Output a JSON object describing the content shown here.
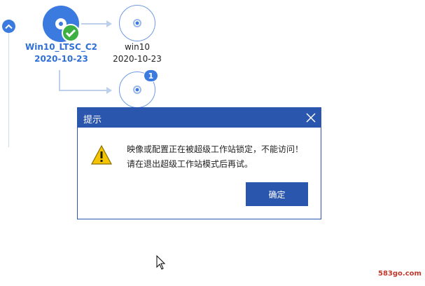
{
  "timeline": {
    "nodes": [
      {
        "name": "Win10_LTSC_C2",
        "date": "2020-10-23"
      },
      {
        "name": "win10",
        "date": "2020-10-23"
      }
    ],
    "badge_count": "1"
  },
  "dialog": {
    "title": "提示",
    "message_line1": "映像或配置正在被超级工作站锁定，不能访问！",
    "message_line2": "请在退出超级工作站模式后再试。",
    "ok_label": "确定"
  },
  "watermark": "583go.com",
  "colors": {
    "accent": "#3b7be0",
    "dialog_header": "#2b56ad",
    "check_green": "#3cb043",
    "warning_yellow": "#f5c400"
  }
}
